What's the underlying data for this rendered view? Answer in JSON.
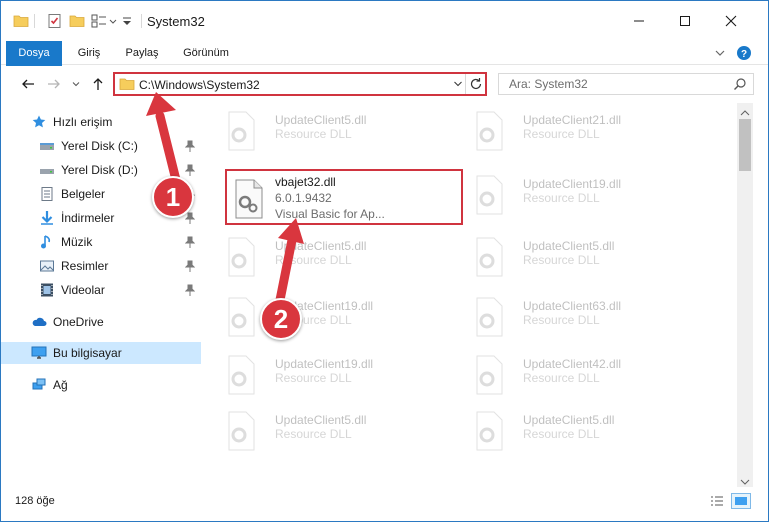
{
  "window": {
    "title": "System32",
    "minimize_icon": "minimize-icon",
    "maximize_icon": "maximize-icon",
    "close_icon": "close-icon"
  },
  "ribbon": {
    "tabs": [
      {
        "label": "Dosya",
        "active": true
      },
      {
        "label": "Giriş"
      },
      {
        "label": "Paylaş"
      },
      {
        "label": "Görünüm"
      }
    ]
  },
  "address": {
    "path": "C:\\Windows\\System32",
    "search_placeholder": "Ara: System32"
  },
  "sidebar": {
    "items": [
      {
        "label": "Hızlı erişim",
        "icon": "star-icon"
      },
      {
        "label": "Yerel Disk (C:)",
        "icon": "drive-icon",
        "pinned": true
      },
      {
        "label": "Yerel Disk (D:)",
        "icon": "drive-icon",
        "pinned": true
      },
      {
        "label": "Belgeler",
        "icon": "documents-icon",
        "pinned": true
      },
      {
        "label": "İndirmeler",
        "icon": "downloads-icon",
        "pinned": true
      },
      {
        "label": "Müzik",
        "icon": "music-icon",
        "pinned": true
      },
      {
        "label": "Resimler",
        "icon": "pictures-icon",
        "pinned": true
      },
      {
        "label": "Videolar",
        "icon": "videos-icon",
        "pinned": true
      },
      {
        "label": "OneDrive",
        "icon": "cloud-icon"
      },
      {
        "label": "Bu bilgisayar",
        "icon": "computer-icon",
        "selected": true
      },
      {
        "label": "Ağ",
        "icon": "network-icon"
      }
    ]
  },
  "files": {
    "highlighted": {
      "name": "vbajet32.dll",
      "version": "6.0.1.9432",
      "description": "Visual Basic for Ap..."
    },
    "left_column": [
      {
        "name": "UpdateClient5.dll",
        "description": "Resource DLL"
      },
      {
        "name": "UpdateClient5.dll",
        "description": "Resource DLL"
      },
      {
        "name": "UpdateClient19.dll",
        "description": "Resource DLL"
      },
      {
        "name": "UpdateClient19.dll",
        "description": "Resource DLL"
      },
      {
        "name": "UpdateClient5.dll",
        "description": "Resource DLL"
      }
    ],
    "right_column": [
      {
        "name": "UpdateClient21.dll",
        "description": "Resource DLL"
      },
      {
        "name": "UpdateClient19.dll",
        "description": "Resource DLL"
      },
      {
        "name": "UpdateClient5.dll",
        "description": "Resource DLL"
      },
      {
        "name": "UpdateClient63.dll",
        "description": "Resource DLL"
      },
      {
        "name": "UpdateClient42.dll",
        "description": "Resource DLL"
      },
      {
        "name": "UpdateClient5.dll",
        "description": "Resource DLL"
      }
    ]
  },
  "status": {
    "count": "128 öğe"
  },
  "annotations": {
    "step1": "1",
    "step2": "2",
    "color": "#d9363e"
  }
}
